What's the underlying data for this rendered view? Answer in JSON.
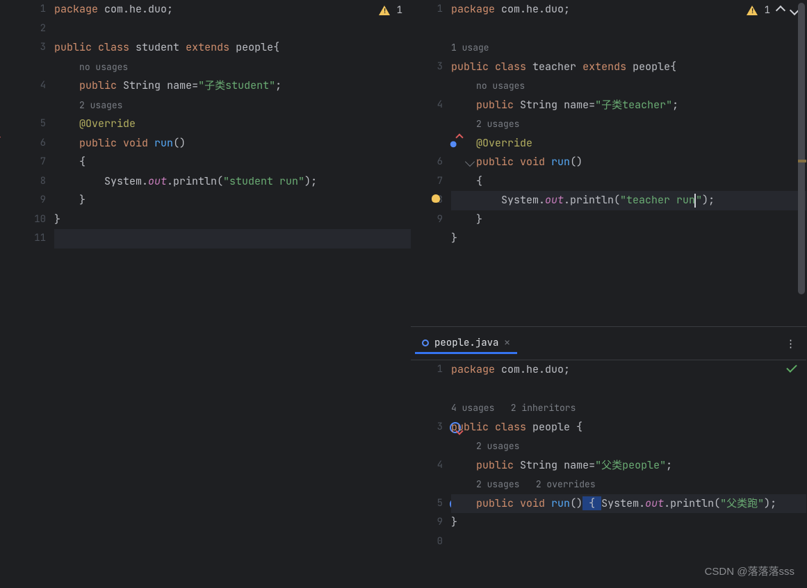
{
  "watermark": "CSDN @落落落sss",
  "topLeft": {
    "warnCount": "1",
    "lines": [
      {
        "n": "1",
        "html": "<span class='kw'>package</span> <span class='pkg'>com.he.duo</span>;"
      },
      {
        "n": "",
        "html": ""
      },
      {
        "n": "",
        "html": "<span class='hint'>1 usage</span>"
      },
      {
        "n": "3",
        "html": "<span class='kw'>public class</span> <span class='ident'>teacher</span> <span class='kw'>extends</span> <span class='ident'>people</span>{"
      },
      {
        "n": "",
        "html": "    <span class='hint'>no usages</span>"
      },
      {
        "n": "4",
        "html": "    <span class='kw'>public</span> <span class='ident'>String</span> <span class='ident'>name</span>=<span class='str'>\"子类teacher\"</span>;"
      },
      {
        "n": "",
        "html": "    <span class='hint'>2 usages</span>"
      },
      {
        "n": "",
        "html": "    <span class='ann'>@Override</span>",
        "override": true
      },
      {
        "n": "6",
        "html": "    <span class='kw'>public void</span> <span class='mname'>run</span>()",
        "chev": true
      },
      {
        "n": "7",
        "html": "    {"
      },
      {
        "n": "8",
        "html": "        System.<span class='field'>out</span>.println(<span class='str'>\"teacher run</span><span class='caret'></span><span class='str'>\"</span>);",
        "cur": true,
        "bulb": true
      },
      {
        "n": "9",
        "html": "    }"
      },
      {
        "n": "",
        "html": "}"
      },
      {
        "n": "",
        "html": ""
      }
    ]
  },
  "bottomLeft": {
    "tabName": "people.java",
    "lines": [
      {
        "n": "1",
        "html": "<span class='kw'>package</span> <span class='pkg'>com.he.duo</span>;"
      },
      {
        "n": "",
        "html": ""
      },
      {
        "n": "",
        "html": "<span class='hint'>4 usages&nbsp;&nbsp;&nbsp;2 inheritors</span>"
      },
      {
        "n": "3",
        "html": "<span class='kw'>public class</span> <span class='ident'>people</span> {",
        "icond": true
      },
      {
        "n": "",
        "html": "    <span class='hint'>2 usages</span>"
      },
      {
        "n": "4",
        "html": "    <span class='kw'>public</span> <span class='ident'>String</span> <span class='ident'>name</span>=<span class='str'>\"父类people\"</span>;"
      },
      {
        "n": "",
        "html": "    <span class='hint'>2 usages&nbsp;&nbsp;&nbsp;2 overrides</span>"
      },
      {
        "n": "5",
        "html": "    <span class='kw'>public void</span> <span class='mname'>run</span>()<span class='sel'> { </span>System.<span class='field'>out</span>.println(<span class='str'>\"父类跑\"</span>);",
        "cur": true,
        "icond": true,
        "chevr": true
      },
      {
        "n": "9",
        "html": "}"
      },
      {
        "n": "0",
        "html": ""
      }
    ]
  },
  "right": {
    "warnCount": "1",
    "lines": [
      {
        "n": "1",
        "html": "<span class='kw'>package</span> <span class='pkg'>com.he.duo</span>;"
      },
      {
        "n": "2",
        "html": ""
      },
      {
        "n": "3",
        "html": "<span class='kw'>public class</span> <span class='ident'>student</span> <span class='kw'>extends</span> <span class='ident'>people</span>{"
      },
      {
        "n": "",
        "html": "    <span class='hint'>no usages</span>"
      },
      {
        "n": "4",
        "html": "    <span class='kw'>public</span> <span class='ident'>String</span> <span class='ident'>name</span>=<span class='str'>\"子类student\"</span>;"
      },
      {
        "n": "",
        "html": "    <span class='hint'>2 usages</span>"
      },
      {
        "n": "5",
        "html": "    <span class='ann'>@Override</span>"
      },
      {
        "n": "6",
        "html": "    <span class='kw'>public void</span> <span class='mname'>run</span>()",
        "tgt": true
      },
      {
        "n": "7",
        "html": "    {"
      },
      {
        "n": "8",
        "html": "        System.<span class='field'>out</span>.println(<span class='str'>\"student run\"</span>);"
      },
      {
        "n": "9",
        "html": "    }"
      },
      {
        "n": "10",
        "html": "}"
      },
      {
        "n": "11",
        "html": "",
        "cur": true
      }
    ]
  }
}
